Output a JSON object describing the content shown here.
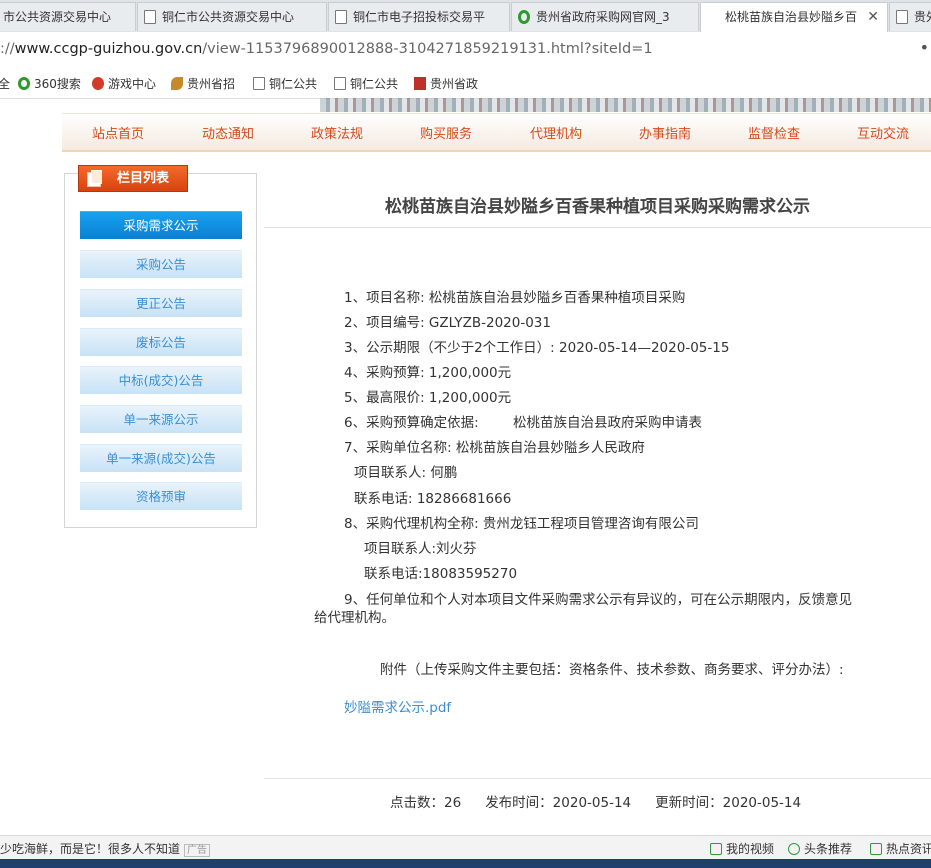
{
  "browser": {
    "tabs": [
      {
        "label": "市公共资源交易中心",
        "icon": "doc-icon"
      },
      {
        "label": "铜仁市公共资源交易中心",
        "icon": "doc-icon"
      },
      {
        "label": "铜仁市电子招投标交易平",
        "icon": "doc-icon"
      },
      {
        "label": "贵州省政府采购网官网_3",
        "icon": "360-search-icon"
      },
      {
        "label": "松桃苗族自治县妙隘乡百",
        "icon": "doc-icon",
        "active": true
      },
      {
        "label": "贵外",
        "icon": "doc-icon"
      }
    ],
    "url_prefix": "://",
    "url_host": "www.ccgp-guizhou.gov.cn",
    "url_path": "/view-1153796890012888-3104271859219131.html?siteId=1",
    "bookmarks": [
      {
        "label": "全",
        "icon": ""
      },
      {
        "label": "360搜索",
        "icon": "360-search-icon"
      },
      {
        "label": "游戏中心",
        "icon": "game-icon"
      },
      {
        "label": "贵州省招",
        "icon": "leaf-icon"
      },
      {
        "label": "铜仁公共",
        "icon": "doc-icon"
      },
      {
        "label": "铜仁公共",
        "icon": "doc-icon"
      },
      {
        "label": "贵州省政",
        "icon": "red-icon"
      }
    ]
  },
  "nav": {
    "items": [
      "站点首页",
      "动态通知",
      "政策法规",
      "购买服务",
      "代理机构",
      "办事指南",
      "监督检查",
      "互动交流"
    ]
  },
  "sidebar": {
    "title": "栏目列表",
    "items": [
      "采购需求公示",
      "采购公告",
      "更正公告",
      "废标公告",
      "中标(成交)公告",
      "单一来源公示",
      "单一来源(成交)公告",
      "资格预审"
    ]
  },
  "article": {
    "title": "松桃苗族自治县妙隘乡百香果种植项目采购采购需求公示",
    "lines": [
      "1、项目名称: 松桃苗族自治县妙隘乡百香果种植项目采购",
      "2、项目编号: GZLYZB-2020-031",
      "3、公示期限（不少于2个工作日）: 2020-05-14—2020-05-15",
      "4、采购预算: 1,200,000元",
      "5、最高限价: 1,200,000元",
      "6、采购预算确定依据:        松桃苗族自治县政府采购申请表",
      "7、采购单位名称: 松桃苗族自治县妙隘乡人民政府",
      "项目联系人: 何鹏",
      "联系电话: 18286681666",
      "8、采购代理机构全称: 贵州龙钰工程项目管理咨询有限公司",
      "项目联系人:刘火芬",
      "联系电话:18083595270",
      "9、任何单位和个人对本项目文件采购需求公示有异议的，可在公示期限内，反馈意见",
      "给代理机构。"
    ],
    "attachment_note": "附件（上传采购文件主要包括：资格条件、技术参数、商务要求、评分办法）:",
    "attachment_link": "妙隘需求公示.pdf"
  },
  "footer": {
    "clicks": "点击数：26",
    "published": "发布时间：2020-05-14",
    "updated": "更新时间：2020-05-14"
  },
  "statusbar": {
    "left_text": "少吃海鲜，而是它！很多人不知道",
    "ad_label": "广告",
    "items": [
      "我的视频",
      "头条推荐",
      "热点资讯"
    ]
  }
}
